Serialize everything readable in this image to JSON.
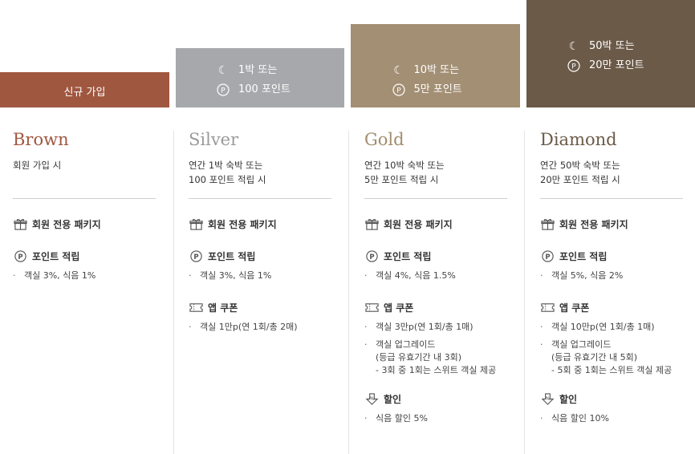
{
  "bars": {
    "brown": {
      "label": "신규 가입"
    },
    "silver": {
      "line1": "1박 또는",
      "line2": "100 포인트"
    },
    "gold": {
      "line1": "10박 또는",
      "line2": "5만 포인트"
    },
    "diamond": {
      "line1": "50박 또는",
      "line2": "20만 포인트"
    }
  },
  "tiers": {
    "brown": {
      "name": "Brown",
      "cond": [
        "회원 가입 시"
      ],
      "package": "회원 전용 패키지",
      "points_title": "포인트 적립",
      "points": "객실 3%, 식음 1%"
    },
    "silver": {
      "name": "Silver",
      "cond": [
        "연간 1박 숙박 또는",
        "100 포인트 적립 시"
      ],
      "package": "회원 전용 패키지",
      "points_title": "포인트 적립",
      "points": "객실 3%, 식음 1%",
      "coupon_title": "앱 쿠폰",
      "coupons": [
        "객실 1만p(연 1회/총 2매)"
      ]
    },
    "gold": {
      "name": "Gold",
      "cond": [
        "연간 10박 숙박 또는",
        "5만 포인트 적립 시"
      ],
      "package": "회원 전용 패키지",
      "points_title": "포인트 적립",
      "points": "객실 4%, 식음 1.5%",
      "coupon_title": "앱 쿠폰",
      "coupon1": "객실 3만p(연 1회/총 1매)",
      "coupon2": "객실 업그레이드",
      "coupon2_sub1": "(등급 유효기간 내 3회)",
      "coupon2_sub2": "- 3회 중 1회는 스위트 객실 제공",
      "discount_title": "할인",
      "discount": "식음 할인 5%"
    },
    "diamond": {
      "name": "Diamond",
      "cond": [
        "연간 50박 숙박 또는",
        "20만 포인트 적립 시"
      ],
      "package": "회원 전용 패키지",
      "points_title": "포인트 적립",
      "points": "객실 5%, 식음 2%",
      "coupon_title": "앱 쿠폰",
      "coupon1": "객실 10만p(연 1회/총 1매)",
      "coupon2": "객실 업그레이드",
      "coupon2_sub1": "(등급 유효기간 내 5회)",
      "coupon2_sub2": "- 5회 중 1회는 스위트 객실 제공",
      "discount_title": "할인",
      "discount": "식음 할인 10%"
    }
  },
  "icons": [
    "moon-icon",
    "point-icon",
    "gift-icon",
    "coupon-icon",
    "discount-icon"
  ],
  "colors": {
    "brown": "#a0573f",
    "silver": "#a6a8ab",
    "gold": "#a38f74",
    "diamond": "#6b5a48"
  }
}
